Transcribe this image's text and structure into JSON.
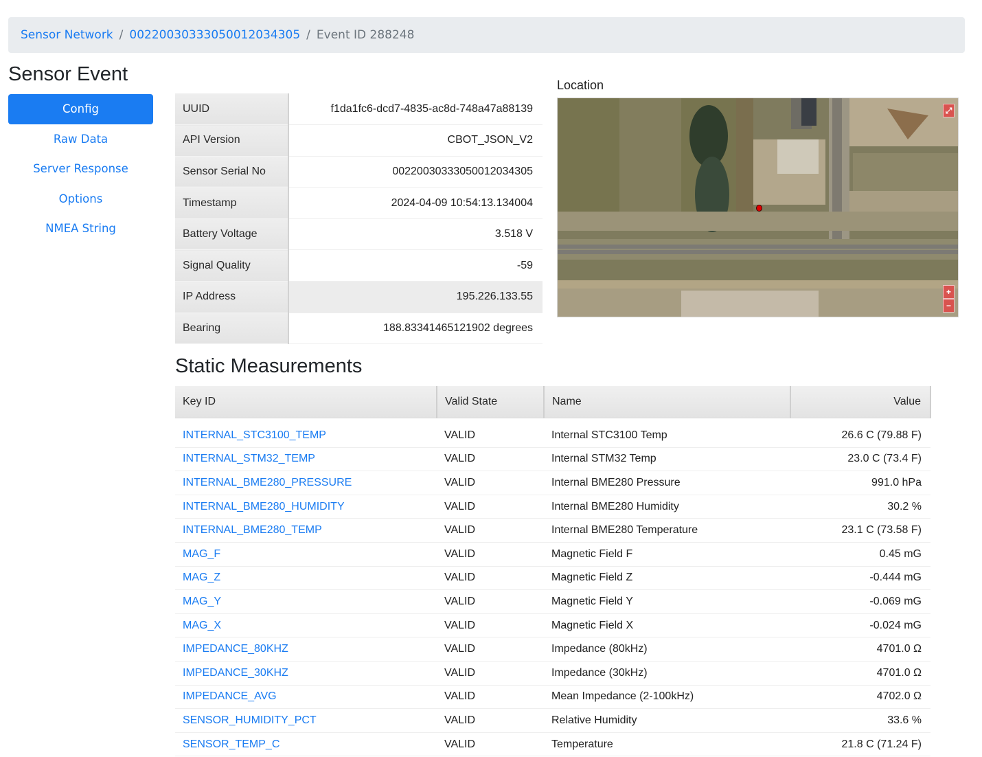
{
  "breadcrumb": {
    "items": [
      {
        "label": "Sensor Network"
      },
      {
        "label": "00220030333050012034305"
      },
      {
        "label": "Event ID 288248"
      }
    ],
    "separator": "/"
  },
  "page": {
    "title": "Sensor Event"
  },
  "sidebar": {
    "items": [
      {
        "label": "Config",
        "active": true
      },
      {
        "label": "Raw Data"
      },
      {
        "label": "Server Response"
      },
      {
        "label": "Options"
      },
      {
        "label": "NMEA String"
      }
    ]
  },
  "info": {
    "rows": [
      {
        "key": "UUID",
        "value": "f1da1fc6-dcd7-4835-ac8d-748a47a88139"
      },
      {
        "key": "API Version",
        "value": "CBOT_JSON_V2"
      },
      {
        "key": "Sensor Serial No",
        "value": "00220030333050012034305"
      },
      {
        "key": "Timestamp",
        "value": "2024-04-09 10:54:13.134004"
      },
      {
        "key": "Battery Voltage",
        "value": "3.518 V"
      },
      {
        "key": "Signal Quality",
        "value": "-59"
      },
      {
        "key": "IP Address",
        "value": "195.226.133.55"
      },
      {
        "key": "Bearing",
        "value": "188.83341465121902 degrees"
      }
    ]
  },
  "location": {
    "label": "Location",
    "controls": {
      "fullscreen": "⤢",
      "zoom_in": "+",
      "zoom_out": "−"
    }
  },
  "measurements": {
    "title": "Static Measurements",
    "columns": [
      "Key ID",
      "Valid State",
      "Name",
      "Value"
    ],
    "rows": [
      {
        "key": "INTERNAL_STC3100_TEMP",
        "state": "VALID",
        "name": "Internal STC3100 Temp",
        "value": "26.6 C (79.88 F)"
      },
      {
        "key": "INTERNAL_STM32_TEMP",
        "state": "VALID",
        "name": "Internal STM32 Temp",
        "value": "23.0 C (73.4 F)"
      },
      {
        "key": "INTERNAL_BME280_PRESSURE",
        "state": "VALID",
        "name": "Internal BME280 Pressure",
        "value": "991.0 hPa"
      },
      {
        "key": "INTERNAL_BME280_HUMIDITY",
        "state": "VALID",
        "name": "Internal BME280 Humidity",
        "value": "30.2 %"
      },
      {
        "key": "INTERNAL_BME280_TEMP",
        "state": "VALID",
        "name": "Internal BME280 Temperature",
        "value": "23.1 C (73.58 F)"
      },
      {
        "key": "MAG_F",
        "state": "VALID",
        "name": "Magnetic Field F",
        "value": "0.45 mG"
      },
      {
        "key": "MAG_Z",
        "state": "VALID",
        "name": "Magnetic Field Z",
        "value": "-0.444 mG"
      },
      {
        "key": "MAG_Y",
        "state": "VALID",
        "name": "Magnetic Field Y",
        "value": "-0.069 mG"
      },
      {
        "key": "MAG_X",
        "state": "VALID",
        "name": "Magnetic Field X",
        "value": "-0.024 mG"
      },
      {
        "key": "IMPEDANCE_80KHZ",
        "state": "VALID",
        "name": "Impedance (80kHz)",
        "value": "4701.0 Ω"
      },
      {
        "key": "IMPEDANCE_30KHZ",
        "state": "VALID",
        "name": "Impedance (30kHz)",
        "value": "4701.0 Ω"
      },
      {
        "key": "IMPEDANCE_AVG",
        "state": "VALID",
        "name": "Mean Impedance (2-100kHz)",
        "value": "4702.0 Ω"
      },
      {
        "key": "SENSOR_HUMIDITY_PCT",
        "state": "VALID",
        "name": "Relative Humidity",
        "value": "33.6 %"
      },
      {
        "key": "SENSOR_TEMP_C",
        "state": "VALID",
        "name": "Temperature",
        "value": "21.8 C (71.24 F)"
      }
    ]
  }
}
